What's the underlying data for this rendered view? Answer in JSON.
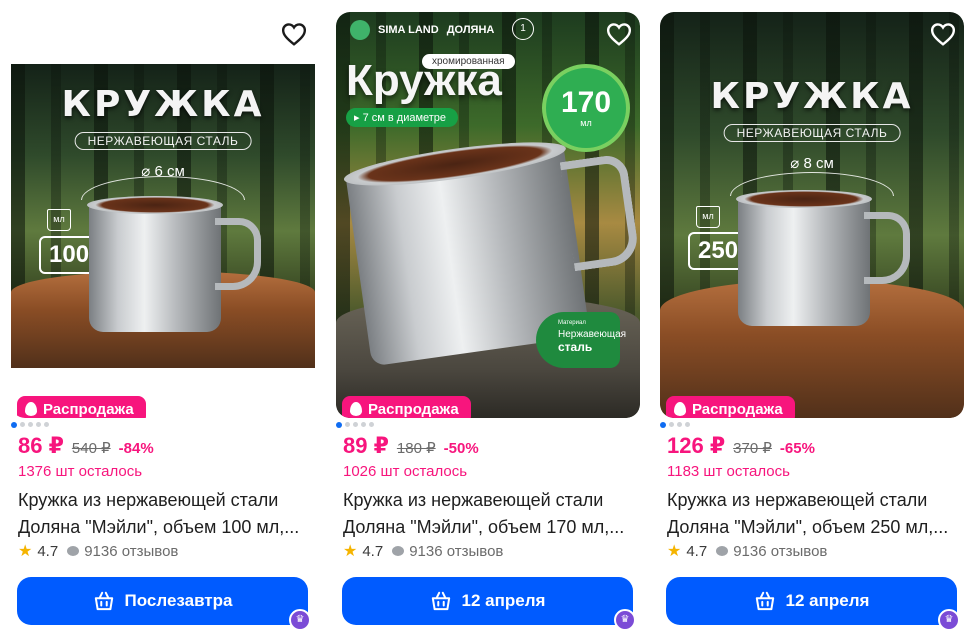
{
  "colors": {
    "accent": "#f7157d",
    "button": "#005bff",
    "rating_star": "#f5b400",
    "premium": "#7b4bd6"
  },
  "icons": {
    "favorite": "heart-icon",
    "sale": "fire-icon",
    "rating": "star-icon",
    "reviews": "chat-bubble-icon",
    "cart": "basket-icon",
    "premium": "crown-icon"
  },
  "products": [
    {
      "image": {
        "title": "КРУЖКА",
        "subtitle": "НЕРЖАВЕЮЩАЯ СТАЛЬ",
        "diameter": "6 см",
        "volume_unit": "мл",
        "volume": "100"
      },
      "sale_label": "Распродажа",
      "gallery": {
        "count": 5,
        "active": 0
      },
      "price": "86 ₽",
      "old_price": "540 ₽",
      "discount": "-84%",
      "stock": "1376 шт осталось",
      "name_line1": "Кружка из нержавеющей стали",
      "name_line2": "Доляна \"Мэйли\", объем 100 мл,...",
      "rating": "4.7",
      "reviews": "9136 отзывов",
      "delivery_label": "Послезавтра"
    },
    {
      "image": {
        "brand": "SIMA LAND",
        "brand2": "ДОЛЯНА",
        "page": "1",
        "tag": "хромированная",
        "title": "Кружка",
        "diameter_pill": "7 см в диаметре",
        "volume": "170",
        "volume_unit": "мл",
        "material_head": "Материал",
        "material_line1": "Нержавеющая",
        "material_line2": "сталь"
      },
      "sale_label": "Распродажа",
      "gallery": {
        "count": 5,
        "active": 0
      },
      "price": "89 ₽",
      "old_price": "180 ₽",
      "discount": "-50%",
      "stock": "1026 шт осталось",
      "name_line1": "Кружка из нержавеющей стали",
      "name_line2": "Доляна \"Мэйли\", объем 170 мл,...",
      "rating": "4.7",
      "reviews": "9136 отзывов",
      "delivery_label": "12 апреля"
    },
    {
      "image": {
        "title": "КРУЖКА",
        "subtitle": "НЕРЖАВЕЮЩАЯ СТАЛЬ",
        "diameter": "8 см",
        "volume_unit": "мл",
        "volume": "250"
      },
      "sale_label": "Распродажа",
      "gallery": {
        "count": 4,
        "active": 0
      },
      "price": "126 ₽",
      "old_price": "370 ₽",
      "discount": "-65%",
      "stock": "1183 шт осталось",
      "name_line1": "Кружка из нержавеющей стали",
      "name_line2": "Доляна \"Мэйли\", объем 250 мл,...",
      "rating": "4.7",
      "reviews": "9136 отзывов",
      "delivery_label": "12 апреля"
    }
  ]
}
